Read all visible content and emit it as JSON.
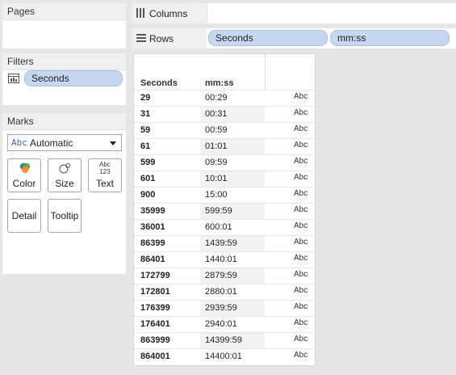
{
  "pages": {
    "title": "Pages"
  },
  "filters": {
    "title": "Filters",
    "pill": "Seconds"
  },
  "marks": {
    "title": "Marks",
    "dropdown_icon_text": "Abc",
    "dropdown_value": "Automatic",
    "buttons": [
      {
        "label": "Color",
        "icon": "color-icon"
      },
      {
        "label": "Size",
        "icon": "size-icon"
      },
      {
        "label": "Text",
        "icon": "text-icon",
        "icon_text_top": "Abc",
        "icon_text_bottom": "123"
      },
      {
        "label": "Detail",
        "icon": "detail-icon"
      },
      {
        "label": "Tooltip",
        "icon": "tooltip-icon"
      }
    ]
  },
  "shelves": {
    "columns_label": "Columns",
    "rows_label": "Rows",
    "rows_pills": [
      "Seconds",
      "mm:ss"
    ]
  },
  "table": {
    "headers": [
      "Seconds",
      "mm:ss"
    ],
    "rows": [
      {
        "seconds": "29",
        "mmss": "00:29",
        "mark": "Abc"
      },
      {
        "seconds": "31",
        "mmss": "00:31",
        "mark": "Abc"
      },
      {
        "seconds": "59",
        "mmss": "00:59",
        "mark": "Abc"
      },
      {
        "seconds": "61",
        "mmss": "01:01",
        "mark": "Abc"
      },
      {
        "seconds": "599",
        "mmss": "09:59",
        "mark": "Abc"
      },
      {
        "seconds": "601",
        "mmss": "10:01",
        "mark": "Abc"
      },
      {
        "seconds": "900",
        "mmss": "15:00",
        "mark": "Abc"
      },
      {
        "seconds": "35999",
        "mmss": "599:59",
        "mark": "Abc"
      },
      {
        "seconds": "36001",
        "mmss": "600:01",
        "mark": "Abc"
      },
      {
        "seconds": "86399",
        "mmss": "1439:59",
        "mark": "Abc"
      },
      {
        "seconds": "86401",
        "mmss": "1440:01",
        "mark": "Abc"
      },
      {
        "seconds": "172799",
        "mmss": "2879:59",
        "mark": "Abc"
      },
      {
        "seconds": "172801",
        "mmss": "2880:01",
        "mark": "Abc"
      },
      {
        "seconds": "176399",
        "mmss": "2939:59",
        "mark": "Abc"
      },
      {
        "seconds": "176401",
        "mmss": "2940:01",
        "mark": "Abc"
      },
      {
        "seconds": "863999",
        "mmss": "14399:59",
        "mark": "Abc"
      },
      {
        "seconds": "864001",
        "mmss": "14400:01",
        "mark": "Abc"
      }
    ]
  }
}
